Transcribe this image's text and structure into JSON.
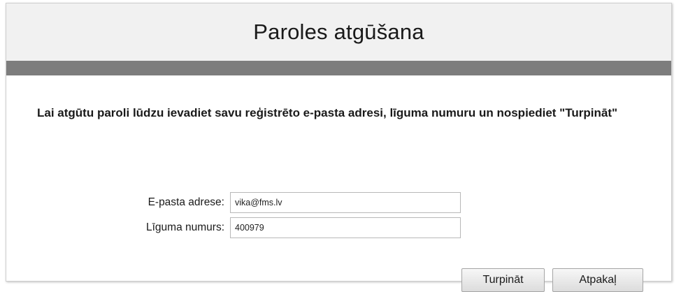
{
  "page": {
    "title": "Paroles atgūšana"
  },
  "form": {
    "instruction": "Lai atgūtu paroli lūdzu ievadiet savu reģistrēto e-pasta adresi, līguma numuru un nospiediet \"Turpināt\"",
    "email_label": "E-pasta adrese:",
    "email_value": "vika@fms.lv",
    "contract_label": "Līguma numurs:",
    "contract_value": "400979"
  },
  "actions": {
    "continue_label": "Turpināt",
    "back_label": "Atpakaļ"
  },
  "colors": {
    "header_bg": "#f1f1f1",
    "band": "#7d7d7d"
  }
}
